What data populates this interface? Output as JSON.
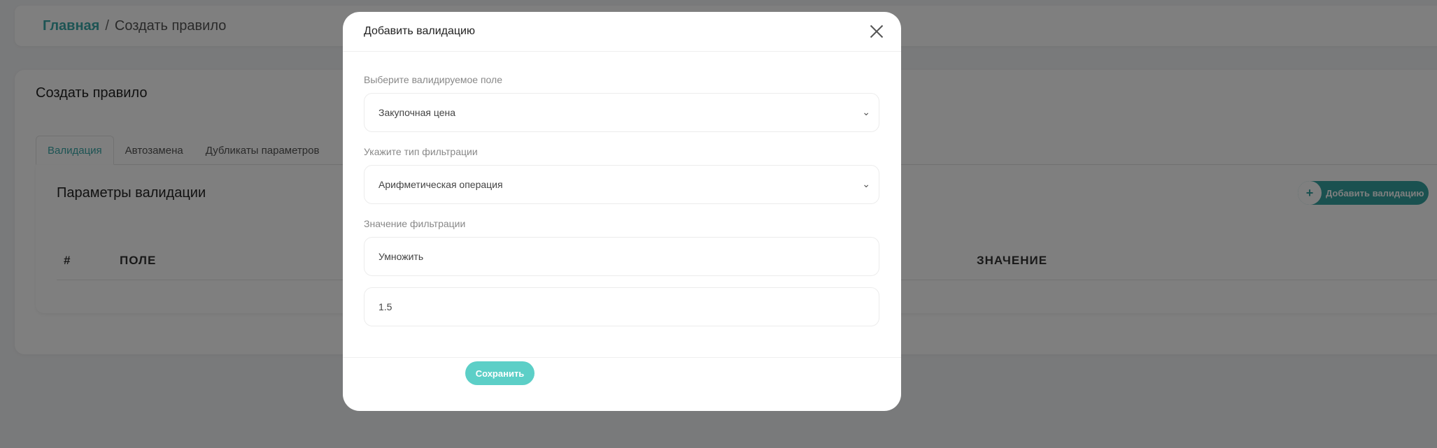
{
  "breadcrumb": {
    "home": "Главная",
    "separator": "/",
    "current": "Создать правило"
  },
  "page": {
    "title": "Создать правило"
  },
  "tabs": [
    {
      "label": "Валидация",
      "active": true
    },
    {
      "label": "Автозамена",
      "active": false
    },
    {
      "label": "Дубликаты параметров",
      "active": false
    }
  ],
  "section": {
    "title": "Параметры валидации",
    "add_button": {
      "icon_text": "+",
      "label": "Добавить валидацию"
    },
    "table_headers": {
      "hash": "#",
      "field": "ПОЛЕ",
      "value": "ЗНАЧЕНИЕ"
    }
  },
  "modal": {
    "title": "Добавить валидацию",
    "field_select": {
      "label": "Выберите валидируемое поле",
      "value": "Закупочная цена"
    },
    "filter_type_select": {
      "label": "Укажите тип фильтрации",
      "value": "Арифметическая операция"
    },
    "filter_value": {
      "label": "Значение фильтрации",
      "operation": "Умножить",
      "number": "1.5"
    },
    "save_label": "Сохранить"
  },
  "colors": {
    "accent": "#35a3a0",
    "save_button": "#5ccfc7",
    "link": "#3aa8a8"
  }
}
